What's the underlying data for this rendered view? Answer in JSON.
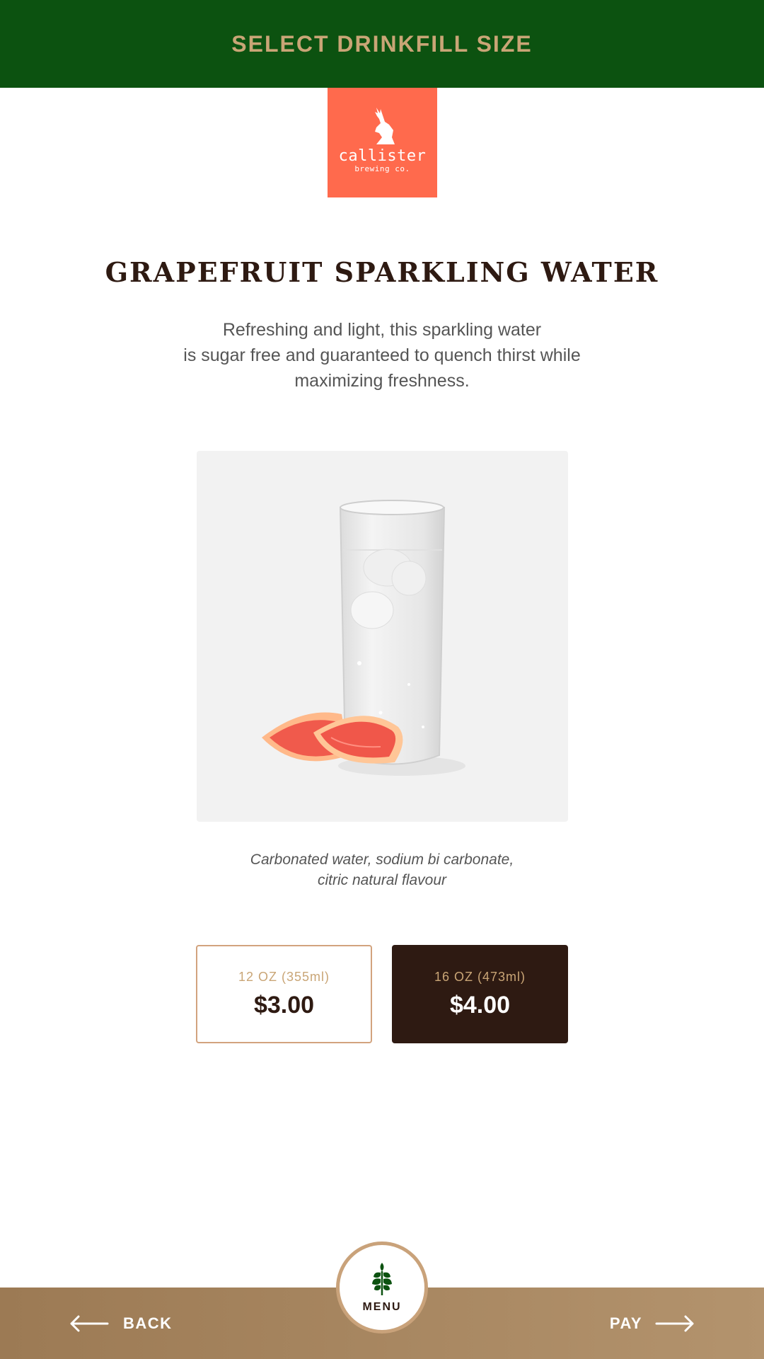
{
  "header": {
    "title": "SELECT DRINKFILL SIZE"
  },
  "brand": {
    "name": "callister",
    "sub": "brewing co.",
    "color": "#ff6a4d"
  },
  "product": {
    "title": "GRAPEFRUIT SPARKLING WATER",
    "description": [
      "Refreshing and light, this sparkling water",
      "is sugar free and guaranteed to quench thirst while",
      "maximizing freshness."
    ],
    "ingredients": [
      "Carbonated water, sodium bi carbonate,",
      "citric natural flavour"
    ]
  },
  "sizes": [
    {
      "label": "12 OZ (355ml)",
      "price": "$3.00",
      "selected": false
    },
    {
      "label": "16 OZ (473ml)",
      "price": "$4.00",
      "selected": true
    }
  ],
  "footer": {
    "back_label": "BACK",
    "pay_label": "PAY",
    "menu_label": "MENU"
  },
  "icons": {
    "back": "arrow-left-icon",
    "pay": "arrow-right-icon",
    "menu": "wheat-leaf-icon",
    "logo": "deer-head-icon"
  },
  "colors": {
    "header_bg": "#0c5210",
    "accent_gold": "#c9a576",
    "dark_brown": "#2e1a12",
    "footer_gradient_start": "#9c7a54",
    "footer_gradient_end": "#b3936d"
  }
}
